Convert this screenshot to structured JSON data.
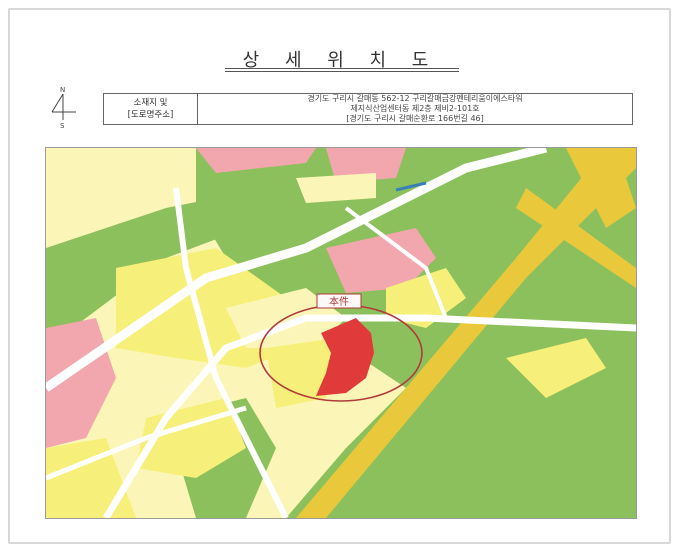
{
  "title": "상 세 위 치 도",
  "north_arrow": {
    "top_letter": "N",
    "bottom_letter": "S"
  },
  "location_table": {
    "label_line1": "소재지 및",
    "label_line2": "[도로명주소]",
    "address_line1": "경기도 구리시 갈매동 562-12 구리갈매금강펜테리움이에스타워",
    "address_line2": "제지식산업센터동 제2층 제비2-101호",
    "address_line3": "[경기도 구리시 갈매순환로 166번길 46]"
  },
  "map": {
    "subject_label": "本件",
    "colors": {
      "green_zone": "#8cc05c",
      "road": "#ffffff",
      "residential_yellow": "#f6f07a",
      "residential_light": "#fbf6b8",
      "commercial_pink": "#f2a6ad",
      "subject_red": "#e03a3a",
      "circle": "#b23a3a",
      "highway": "#e9c93b"
    }
  }
}
